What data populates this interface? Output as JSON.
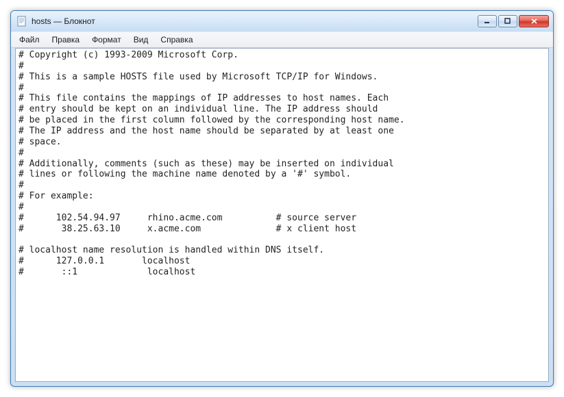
{
  "window": {
    "title": "hosts — Блокнот"
  },
  "menu": {
    "file": "Файл",
    "edit": "Правка",
    "format": "Формат",
    "view": "Вид",
    "help": "Справка"
  },
  "buttons": {
    "minimize": "Minimize",
    "maximize": "Maximize",
    "close": "Close"
  },
  "editor": {
    "content": "# Copyright (c) 1993-2009 Microsoft Corp.\n#\n# This is a sample HOSTS file used by Microsoft TCP/IP for Windows.\n#\n# This file contains the mappings of IP addresses to host names. Each\n# entry should be kept on an individual line. The IP address should\n# be placed in the first column followed by the corresponding host name.\n# The IP address and the host name should be separated by at least one\n# space.\n#\n# Additionally, comments (such as these) may be inserted on individual\n# lines or following the machine name denoted by a '#' symbol.\n#\n# For example:\n#\n#      102.54.94.97     rhino.acme.com          # source server\n#       38.25.63.10     x.acme.com              # x client host\n\n# localhost name resolution is handled within DNS itself.\n#      127.0.0.1       localhost\n#       ::1             localhost"
  }
}
